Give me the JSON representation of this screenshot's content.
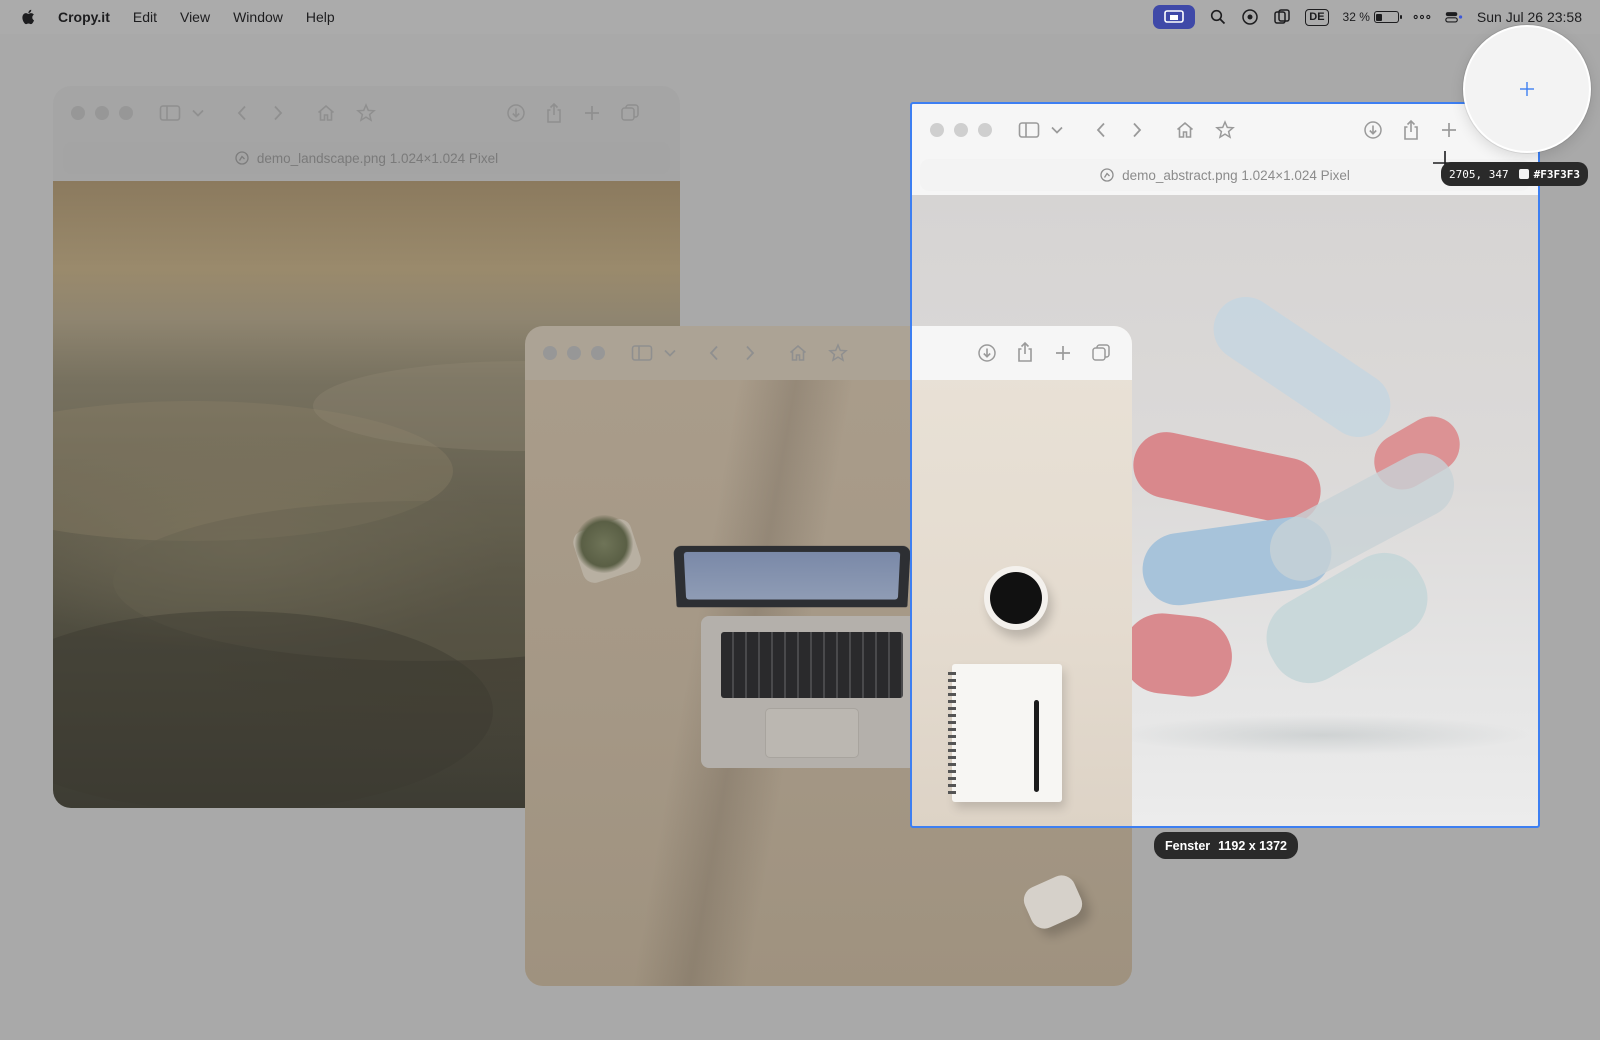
{
  "menubar": {
    "app_name": "Cropy.it",
    "items": [
      "Edit",
      "View",
      "Window",
      "Help"
    ],
    "battery_percent": "32 %",
    "battery_level": 0.32,
    "language": "DE",
    "clock": "Sun Jul 26  23:58"
  },
  "windows": {
    "landscape": {
      "url_text": "demo_landscape.png 1.024×1.024 Pixel"
    },
    "abstract": {
      "url_text": "demo_abstract.png 1.024×1.024 Pixel"
    }
  },
  "capture": {
    "size_label": "Fenster",
    "size_value": "1192 x 1372",
    "coords": "2705, 347",
    "color_hex": "#F3F3F3"
  },
  "colors": {
    "selection": "#3d7ff2",
    "menubar_active_pill": "#3f49a8"
  }
}
